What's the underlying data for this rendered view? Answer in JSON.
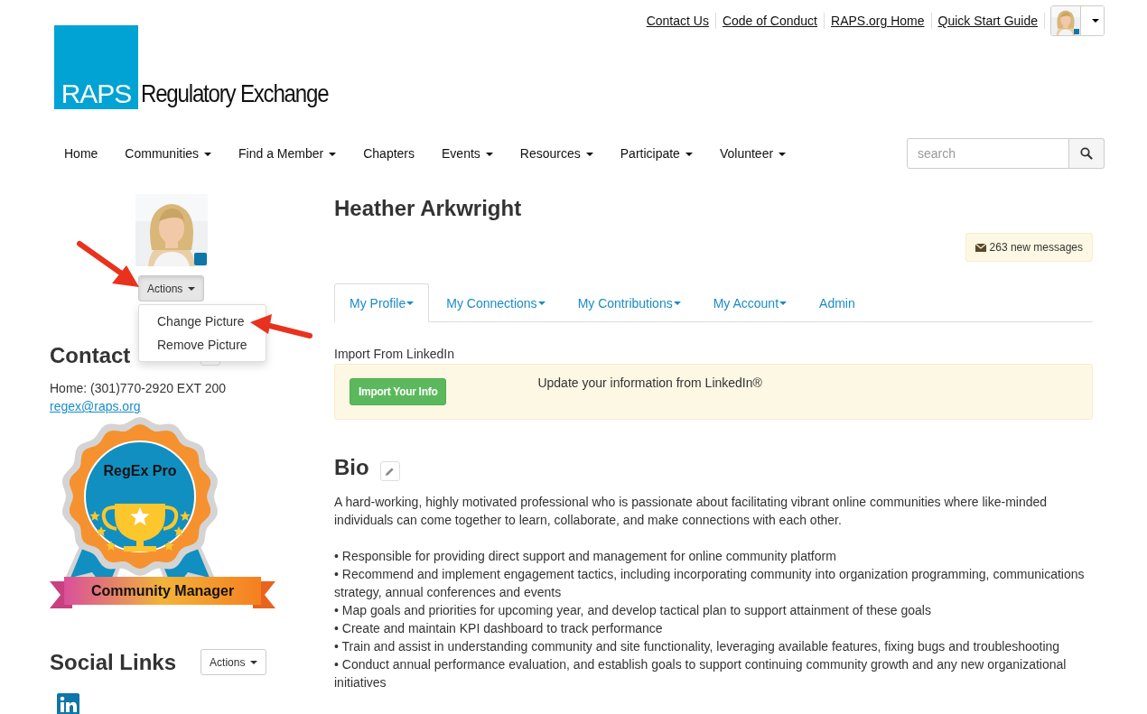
{
  "top_links": [
    "Contact Us",
    "Code of Conduct",
    "RAPS.org Home",
    "Quick Start Guide"
  ],
  "logo": {
    "mark": "RAPS",
    "name": "Regulatory Exchange"
  },
  "nav": [
    {
      "label": "Home",
      "dropdown": false
    },
    {
      "label": "Communities",
      "dropdown": true
    },
    {
      "label": "Find a Member",
      "dropdown": true
    },
    {
      "label": "Chapters",
      "dropdown": false
    },
    {
      "label": "Events",
      "dropdown": true
    },
    {
      "label": "Resources",
      "dropdown": true
    },
    {
      "label": "Participate",
      "dropdown": true
    },
    {
      "label": "Volunteer",
      "dropdown": true
    }
  ],
  "search": {
    "placeholder": "search"
  },
  "sidebar": {
    "photo_actions": "Actions",
    "photo_menu": [
      "Change Picture",
      "Remove Picture"
    ],
    "contact_heading": "Contact",
    "phone": "Home: (301)770-2920 EXT 200",
    "email": "regex@raps.org",
    "badge": {
      "title": "RegEx Pro",
      "ribbon": "Community Manager"
    },
    "social_heading": "Social Links",
    "social_actions": "Actions"
  },
  "profile": {
    "name": "Heather Arkwright",
    "messages": "263 new messages",
    "tabs": [
      {
        "label": "My Profile",
        "dropdown": true,
        "selected": true
      },
      {
        "label": "My Connections",
        "dropdown": true,
        "selected": false
      },
      {
        "label": "My Contributions",
        "dropdown": true,
        "selected": false
      },
      {
        "label": "My Account",
        "dropdown": true,
        "selected": false
      },
      {
        "label": "Admin",
        "dropdown": false,
        "selected": false
      }
    ],
    "import_label": "Import From LinkedIn",
    "import_button": "Import Your Info",
    "import_text": "Update your information from LinkedIn®",
    "bio_heading": "Bio",
    "bio_intro": "A hard-working, highly motivated professional who is passionate about facilitating vibrant online communities where like-minded individuals can come together to learn, collaborate, and make connections with each other.",
    "bio_points": [
      "• Responsible for providing direct support and management for online community platform",
      "• Recommend and implement engagement tactics, including incorporating community into organization programming, communications strategy, annual conferences and events",
      "• Map goals and priorities for upcoming year, and develop tactical plan to support attainment of these goals",
      "• Create and maintain KPI dashboard to track performance",
      "• Train and assist in understanding community and site functionality, leveraging available features, fixing bugs and troubleshooting",
      "• Conduct annual performance evaluation, and establish goals to support continuing community growth and any new organizational initiatives"
    ]
  }
}
